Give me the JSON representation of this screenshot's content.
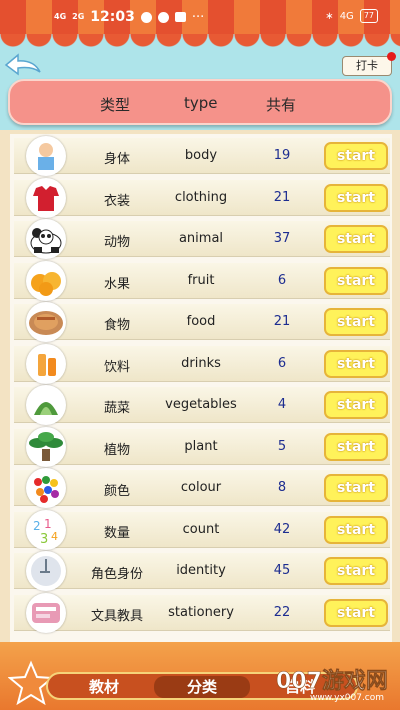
{
  "status_bar": {
    "signal1": "4G",
    "signal2": "2G",
    "time": "12:03",
    "more": "···",
    "bluetooth": "∗",
    "network": "4G",
    "battery": "77"
  },
  "header": {
    "checkin_label": "打卡",
    "col_type_zh": "类型",
    "col_type_en": "type",
    "col_total": "共有"
  },
  "rows": [
    {
      "zh": "身体",
      "en": "body",
      "count": "19",
      "icon": "body-icon"
    },
    {
      "zh": "衣装",
      "en": "clothing",
      "count": "21",
      "icon": "clothing-icon"
    },
    {
      "zh": "动物",
      "en": "animal",
      "count": "37",
      "icon": "panda-icon"
    },
    {
      "zh": "水果",
      "en": "fruit",
      "count": "6",
      "icon": "orange-icon"
    },
    {
      "zh": "食物",
      "en": "food",
      "count": "21",
      "icon": "food-plate-icon"
    },
    {
      "zh": "饮料",
      "en": "drinks",
      "count": "6",
      "icon": "drink-icon"
    },
    {
      "zh": "蔬菜",
      "en": "vegetables",
      "count": "4",
      "icon": "vegetable-icon"
    },
    {
      "zh": "植物",
      "en": "plant",
      "count": "5",
      "icon": "plant-icon"
    },
    {
      "zh": "颜色",
      "en": "colour",
      "count": "8",
      "icon": "colour-candy-icon"
    },
    {
      "zh": "数量",
      "en": "count",
      "count": "42",
      "icon": "numbers-icon"
    },
    {
      "zh": "角色身份",
      "en": "identity",
      "count": "45",
      "icon": "identity-icon"
    },
    {
      "zh": "文具教具",
      "en": "stationery",
      "count": "22",
      "icon": "stationery-icon"
    }
  ],
  "start_label": "start",
  "tabs": [
    {
      "label": "教材"
    },
    {
      "label": "分类"
    },
    {
      "label": "自料"
    }
  ],
  "watermark": "007游戏网",
  "watermark_url": "www.yx007.com",
  "colors": {
    "header_pill": "#f5928a",
    "start_button": "#fff25a",
    "count_text": "#1d2d90",
    "bottom_bar": "#e9782e"
  }
}
